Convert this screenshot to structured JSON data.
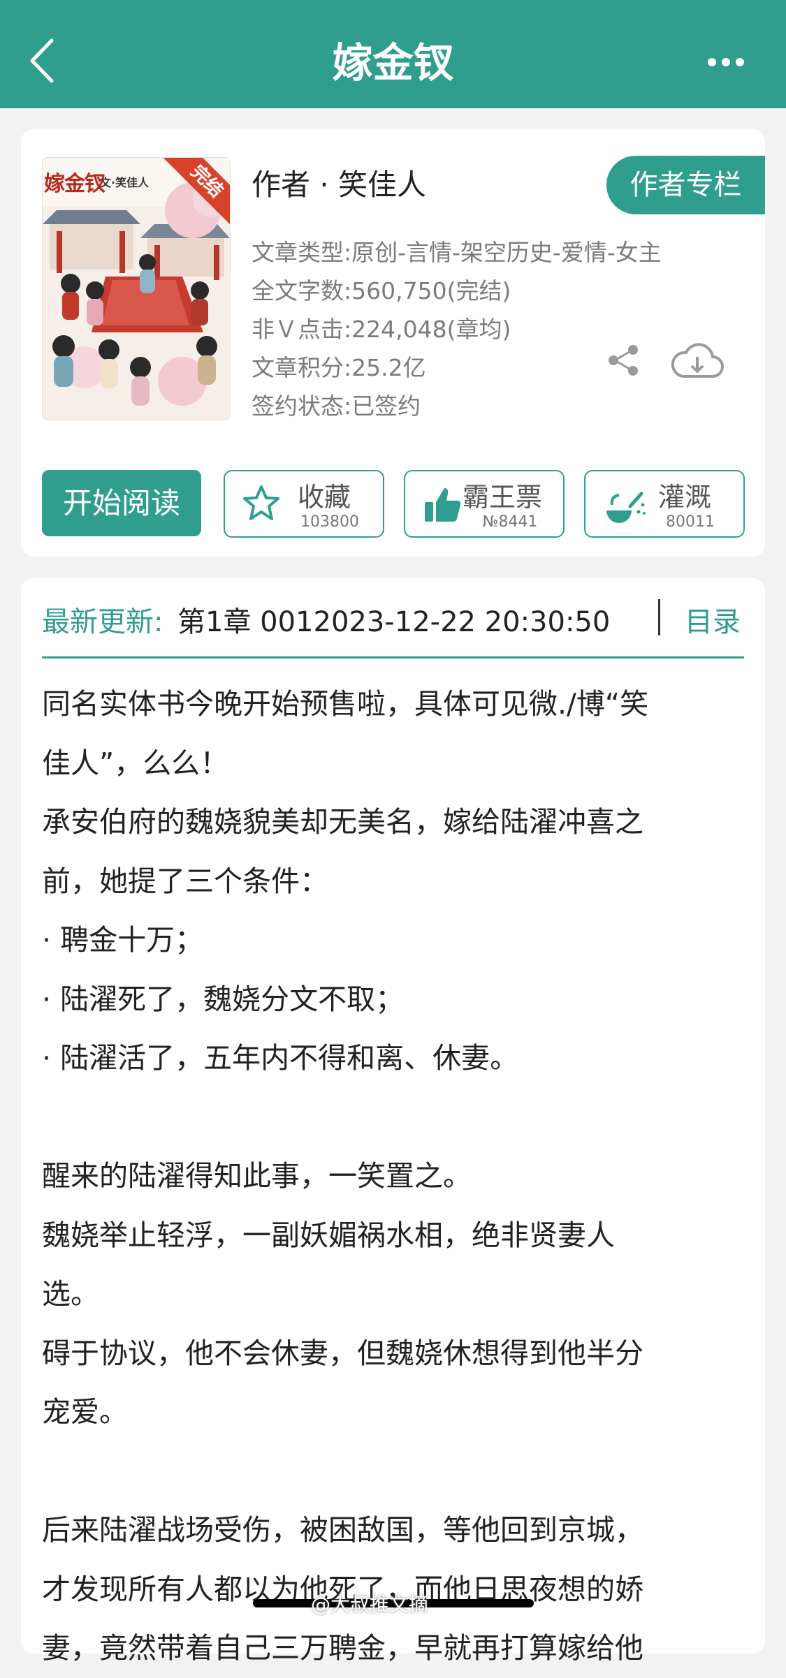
{
  "header": {
    "title": "嫁金钗",
    "back_icon": "chevron-left-icon",
    "more_icon": "more-horizontal-icon"
  },
  "book": {
    "cover": {
      "title": "嫁金钗",
      "byline": "文·笑佳人",
      "badge": "完结"
    },
    "author_line": "作者 · 笑佳人",
    "author_column_label": "作者专栏",
    "meta": [
      "文章类型:原创-言情-架空历史-爱情-女主",
      "全文字数:560,750(完结)",
      "非Ｖ点击:224,048(章均)",
      "文章积分:25.2亿",
      "签约状态:已签约"
    ],
    "share_icon": "share-icon",
    "download_icon": "cloud-download-icon"
  },
  "actions": {
    "start_label": "开始阅读",
    "buttons": [
      {
        "label": "收藏",
        "count": "103800",
        "icon": "star-icon"
      },
      {
        "label": "霸王票",
        "count": "№8441",
        "icon": "thumbs-up-icon"
      },
      {
        "label": "灌溉",
        "count": "80011",
        "icon": "watering-can-icon"
      }
    ]
  },
  "update": {
    "label": "最新更新:",
    "value": "第1章 0012023-12-22 20:30:50",
    "toc_label": "目录"
  },
  "summary": [
    "同名实体书今晚开始预售啦，具体可见微./博“笑",
    "佳人”，么么！",
    "承安伯府的魏娆貌美却无美名，嫁给陆濯冲喜之",
    "前，她提了三个条件：",
    "· 聘金十万；",
    "· 陆濯死了，魏娆分文不取；",
    "· 陆濯活了，五年内不得和离、休妻。",
    "",
    "醒来的陆濯得知此事，一笑置之。",
    "魏娆举止轻浮，一副妖媚祸水相，绝非贤妻人",
    "选。",
    "碍于协议，他不会休妻，但魏娆休想得到他半分",
    "宠爱。",
    "",
    "后来陆濯战场受伤，被困敌国，等他回到京城，",
    "才发现所有人都以为他死了，而他日思夜想的娇",
    "妻，竟然带着自己三万聘金，早就再打算嫁给他"
  ],
  "watermark": "@大叔推文摘",
  "colors": {
    "brand": "#2f9e8f",
    "text": "#222222",
    "meta": "#7b7b7b",
    "badge": "#d7432a"
  }
}
